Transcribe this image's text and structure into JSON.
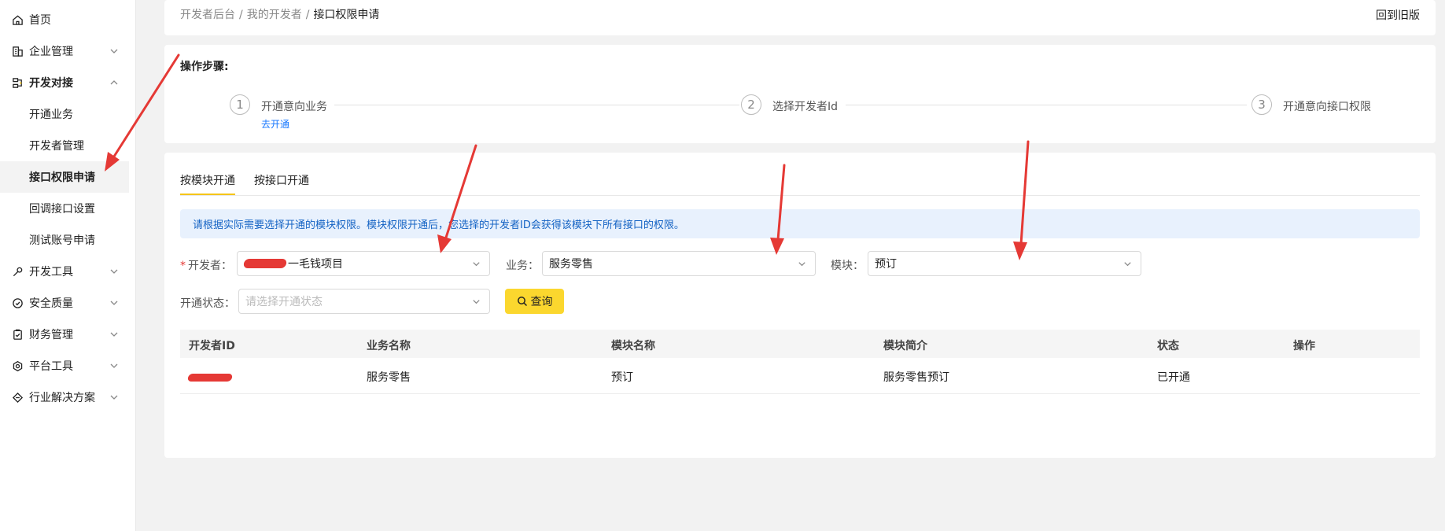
{
  "sidebar": {
    "items": [
      {
        "label": "首页",
        "icon": "home-icon"
      },
      {
        "label": "企业管理",
        "icon": "building-icon"
      },
      {
        "label": "开发对接",
        "icon": "stack-icon"
      },
      {
        "label": "开发工具",
        "icon": "wrench-icon"
      },
      {
        "label": "安全质量",
        "icon": "shield-check-icon"
      },
      {
        "label": "财务管理",
        "icon": "clipboard-check-icon"
      },
      {
        "label": "平台工具",
        "icon": "gear-icon"
      },
      {
        "label": "行业解决方案",
        "icon": "diamond-icon"
      }
    ],
    "sub_items": [
      {
        "label": "开通业务"
      },
      {
        "label": "开发者管理"
      },
      {
        "label": "接口权限申请"
      },
      {
        "label": "回调接口设置"
      },
      {
        "label": "测试账号申请"
      }
    ]
  },
  "header": {
    "breadcrumb": [
      "开发者后台",
      "我的开发者",
      "接口权限申请"
    ],
    "separator": "/",
    "back_to_old": "回到旧版"
  },
  "steps": {
    "title": "操作步骤:",
    "items": [
      {
        "number": "1",
        "label": "开通意向业务",
        "link": "去开通"
      },
      {
        "number": "2",
        "label": "选择开发者Id"
      },
      {
        "number": "3",
        "label": "开通意向接口权限"
      }
    ]
  },
  "tabs": [
    "按模块开通",
    "按接口开通"
  ],
  "notice": "请根据实际需要选择开通的模块权限。模块权限开通后，您选择的开发者ID会获得该模块下所有接口的权限。",
  "filters": {
    "developer": {
      "required_mark": "*",
      "label": "开发者：",
      "value_suffix": "一毛钱项目"
    },
    "business": {
      "label": "业务：",
      "value": "服务零售"
    },
    "module": {
      "label": "模块：",
      "value": "预订"
    },
    "status": {
      "label": "开通状态：",
      "placeholder": "请选择开通状态"
    },
    "query_button": "查询"
  },
  "table": {
    "columns": [
      "开发者ID",
      "业务名称",
      "模块名称",
      "模块简介",
      "状态",
      "操作"
    ],
    "rows": [
      {
        "business": "服务零售",
        "module": "预订",
        "intro": "服务零售预订",
        "status": "已开通",
        "action": ""
      }
    ]
  },
  "colors": {
    "accent_yellow": "#fbd72e",
    "link_blue": "#1677ff",
    "notice_bg": "#e8f1fd",
    "annotation_red": "#e53935"
  }
}
